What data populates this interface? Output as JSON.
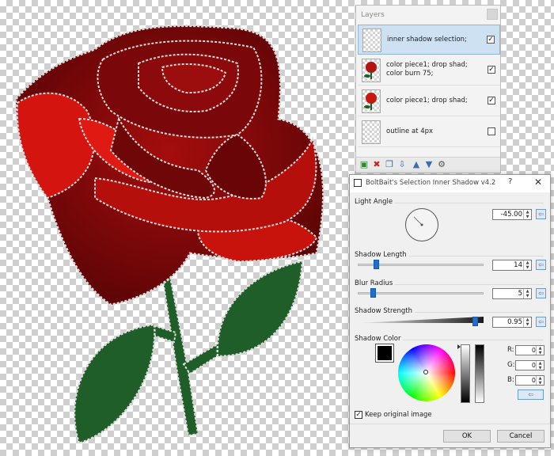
{
  "layers_panel": {
    "title": "Layers",
    "layers": [
      {
        "name": "inner shadow selection;",
        "checked": true,
        "selected": true
      },
      {
        "name": "color piece1; drop shad; color burn 75;",
        "checked": true,
        "selected": false
      },
      {
        "name": "color piece1; drop shad;",
        "checked": true,
        "selected": false
      },
      {
        "name": "outline at 4px",
        "checked": false,
        "selected": false
      }
    ],
    "toolbar_icons": [
      "add-layer-icon",
      "delete-layer-icon",
      "duplicate-layer-icon",
      "merge-layer-icon",
      "move-up-icon",
      "move-down-icon",
      "properties-icon"
    ]
  },
  "dialog": {
    "title": "BoltBait's Selection Inner Shadow v4.2",
    "help_label": "?",
    "close_label": "✕",
    "light_angle": {
      "label": "Light Angle",
      "value": "-45.00"
    },
    "shadow_length": {
      "label": "Shadow Length",
      "value": "14",
      "fraction": 0.14
    },
    "blur_radius": {
      "label": "Blur Radius",
      "value": "5",
      "fraction": 0.05
    },
    "shadow_strength": {
      "label": "Shadow Strength",
      "value": "0.95",
      "fraction": 0.95
    },
    "shadow_color": {
      "label": "Shadow Color",
      "swatch": "#000000",
      "r_label": "R:",
      "r": "0",
      "g_label": "G:",
      "g": "0",
      "b_label": "B:",
      "b": "0"
    },
    "keep_original": {
      "label": "Keep original image",
      "checked": true
    },
    "ok_label": "OK",
    "cancel_label": "Cancel"
  },
  "colors": {
    "rose_dark": "#6e0608",
    "rose_bright": "#d4140e",
    "leaf": "#1f5e28",
    "selection_blue": "#cde1f2",
    "accent": "#1f6fd1"
  }
}
